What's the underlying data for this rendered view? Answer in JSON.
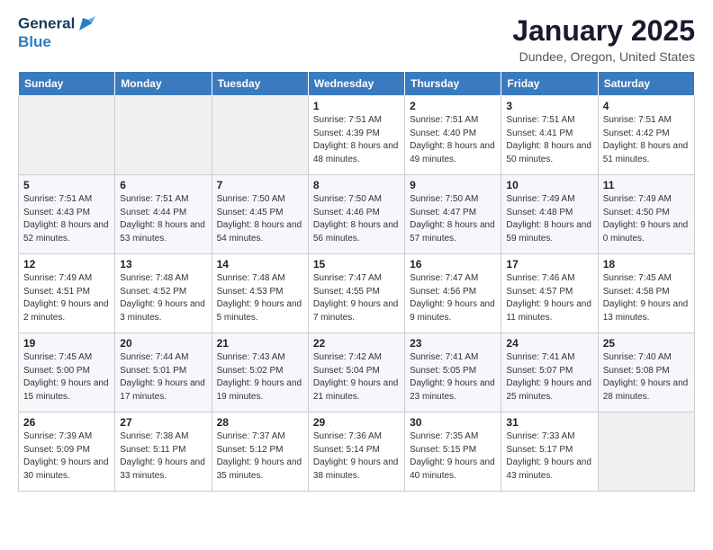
{
  "header": {
    "logo_line1": "General",
    "logo_line2": "Blue",
    "month_title": "January 2025",
    "location": "Dundee, Oregon, United States"
  },
  "weekdays": [
    "Sunday",
    "Monday",
    "Tuesday",
    "Wednesday",
    "Thursday",
    "Friday",
    "Saturday"
  ],
  "weeks": [
    [
      {
        "day": "",
        "sunrise": "",
        "sunset": "",
        "daylight": ""
      },
      {
        "day": "",
        "sunrise": "",
        "sunset": "",
        "daylight": ""
      },
      {
        "day": "",
        "sunrise": "",
        "sunset": "",
        "daylight": ""
      },
      {
        "day": "1",
        "sunrise": "Sunrise: 7:51 AM",
        "sunset": "Sunset: 4:39 PM",
        "daylight": "Daylight: 8 hours and 48 minutes."
      },
      {
        "day": "2",
        "sunrise": "Sunrise: 7:51 AM",
        "sunset": "Sunset: 4:40 PM",
        "daylight": "Daylight: 8 hours and 49 minutes."
      },
      {
        "day": "3",
        "sunrise": "Sunrise: 7:51 AM",
        "sunset": "Sunset: 4:41 PM",
        "daylight": "Daylight: 8 hours and 50 minutes."
      },
      {
        "day": "4",
        "sunrise": "Sunrise: 7:51 AM",
        "sunset": "Sunset: 4:42 PM",
        "daylight": "Daylight: 8 hours and 51 minutes."
      }
    ],
    [
      {
        "day": "5",
        "sunrise": "Sunrise: 7:51 AM",
        "sunset": "Sunset: 4:43 PM",
        "daylight": "Daylight: 8 hours and 52 minutes."
      },
      {
        "day": "6",
        "sunrise": "Sunrise: 7:51 AM",
        "sunset": "Sunset: 4:44 PM",
        "daylight": "Daylight: 8 hours and 53 minutes."
      },
      {
        "day": "7",
        "sunrise": "Sunrise: 7:50 AM",
        "sunset": "Sunset: 4:45 PM",
        "daylight": "Daylight: 8 hours and 54 minutes."
      },
      {
        "day": "8",
        "sunrise": "Sunrise: 7:50 AM",
        "sunset": "Sunset: 4:46 PM",
        "daylight": "Daylight: 8 hours and 56 minutes."
      },
      {
        "day": "9",
        "sunrise": "Sunrise: 7:50 AM",
        "sunset": "Sunset: 4:47 PM",
        "daylight": "Daylight: 8 hours and 57 minutes."
      },
      {
        "day": "10",
        "sunrise": "Sunrise: 7:49 AM",
        "sunset": "Sunset: 4:48 PM",
        "daylight": "Daylight: 8 hours and 59 minutes."
      },
      {
        "day": "11",
        "sunrise": "Sunrise: 7:49 AM",
        "sunset": "Sunset: 4:50 PM",
        "daylight": "Daylight: 9 hours and 0 minutes."
      }
    ],
    [
      {
        "day": "12",
        "sunrise": "Sunrise: 7:49 AM",
        "sunset": "Sunset: 4:51 PM",
        "daylight": "Daylight: 9 hours and 2 minutes."
      },
      {
        "day": "13",
        "sunrise": "Sunrise: 7:48 AM",
        "sunset": "Sunset: 4:52 PM",
        "daylight": "Daylight: 9 hours and 3 minutes."
      },
      {
        "day": "14",
        "sunrise": "Sunrise: 7:48 AM",
        "sunset": "Sunset: 4:53 PM",
        "daylight": "Daylight: 9 hours and 5 minutes."
      },
      {
        "day": "15",
        "sunrise": "Sunrise: 7:47 AM",
        "sunset": "Sunset: 4:55 PM",
        "daylight": "Daylight: 9 hours and 7 minutes."
      },
      {
        "day": "16",
        "sunrise": "Sunrise: 7:47 AM",
        "sunset": "Sunset: 4:56 PM",
        "daylight": "Daylight: 9 hours and 9 minutes."
      },
      {
        "day": "17",
        "sunrise": "Sunrise: 7:46 AM",
        "sunset": "Sunset: 4:57 PM",
        "daylight": "Daylight: 9 hours and 11 minutes."
      },
      {
        "day": "18",
        "sunrise": "Sunrise: 7:45 AM",
        "sunset": "Sunset: 4:58 PM",
        "daylight": "Daylight: 9 hours and 13 minutes."
      }
    ],
    [
      {
        "day": "19",
        "sunrise": "Sunrise: 7:45 AM",
        "sunset": "Sunset: 5:00 PM",
        "daylight": "Daylight: 9 hours and 15 minutes."
      },
      {
        "day": "20",
        "sunrise": "Sunrise: 7:44 AM",
        "sunset": "Sunset: 5:01 PM",
        "daylight": "Daylight: 9 hours and 17 minutes."
      },
      {
        "day": "21",
        "sunrise": "Sunrise: 7:43 AM",
        "sunset": "Sunset: 5:02 PM",
        "daylight": "Daylight: 9 hours and 19 minutes."
      },
      {
        "day": "22",
        "sunrise": "Sunrise: 7:42 AM",
        "sunset": "Sunset: 5:04 PM",
        "daylight": "Daylight: 9 hours and 21 minutes."
      },
      {
        "day": "23",
        "sunrise": "Sunrise: 7:41 AM",
        "sunset": "Sunset: 5:05 PM",
        "daylight": "Daylight: 9 hours and 23 minutes."
      },
      {
        "day": "24",
        "sunrise": "Sunrise: 7:41 AM",
        "sunset": "Sunset: 5:07 PM",
        "daylight": "Daylight: 9 hours and 25 minutes."
      },
      {
        "day": "25",
        "sunrise": "Sunrise: 7:40 AM",
        "sunset": "Sunset: 5:08 PM",
        "daylight": "Daylight: 9 hours and 28 minutes."
      }
    ],
    [
      {
        "day": "26",
        "sunrise": "Sunrise: 7:39 AM",
        "sunset": "Sunset: 5:09 PM",
        "daylight": "Daylight: 9 hours and 30 minutes."
      },
      {
        "day": "27",
        "sunrise": "Sunrise: 7:38 AM",
        "sunset": "Sunset: 5:11 PM",
        "daylight": "Daylight: 9 hours and 33 minutes."
      },
      {
        "day": "28",
        "sunrise": "Sunrise: 7:37 AM",
        "sunset": "Sunset: 5:12 PM",
        "daylight": "Daylight: 9 hours and 35 minutes."
      },
      {
        "day": "29",
        "sunrise": "Sunrise: 7:36 AM",
        "sunset": "Sunset: 5:14 PM",
        "daylight": "Daylight: 9 hours and 38 minutes."
      },
      {
        "day": "30",
        "sunrise": "Sunrise: 7:35 AM",
        "sunset": "Sunset: 5:15 PM",
        "daylight": "Daylight: 9 hours and 40 minutes."
      },
      {
        "day": "31",
        "sunrise": "Sunrise: 7:33 AM",
        "sunset": "Sunset: 5:17 PM",
        "daylight": "Daylight: 9 hours and 43 minutes."
      },
      {
        "day": "",
        "sunrise": "",
        "sunset": "",
        "daylight": ""
      }
    ]
  ]
}
